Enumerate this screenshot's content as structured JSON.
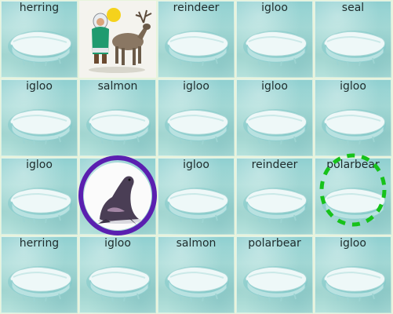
{
  "board": {
    "tiles": [
      {
        "label": "herring",
        "kind": "floe"
      },
      {
        "label": "",
        "kind": "picture-reindeer"
      },
      {
        "label": "reindeer",
        "kind": "floe"
      },
      {
        "label": "igloo",
        "kind": "floe"
      },
      {
        "label": "seal",
        "kind": "floe"
      },
      {
        "label": "igloo",
        "kind": "floe"
      },
      {
        "label": "salmon",
        "kind": "floe"
      },
      {
        "label": "igloo",
        "kind": "floe"
      },
      {
        "label": "igloo",
        "kind": "floe"
      },
      {
        "label": "igloo",
        "kind": "floe"
      },
      {
        "label": "igloo",
        "kind": "floe"
      },
      {
        "label": "",
        "kind": "picture-seal"
      },
      {
        "label": "igloo",
        "kind": "floe"
      },
      {
        "label": "reindeer",
        "kind": "floe"
      },
      {
        "label": "polarbear",
        "kind": "floe"
      },
      {
        "label": "herring",
        "kind": "floe"
      },
      {
        "label": "igloo",
        "kind": "floe"
      },
      {
        "label": "salmon",
        "kind": "floe"
      },
      {
        "label": "polarbear",
        "kind": "floe"
      },
      {
        "label": "igloo",
        "kind": "floe"
      }
    ]
  },
  "colors": {
    "circle_purple": "#5a1fb0",
    "dashed_green": "#17c21a"
  }
}
